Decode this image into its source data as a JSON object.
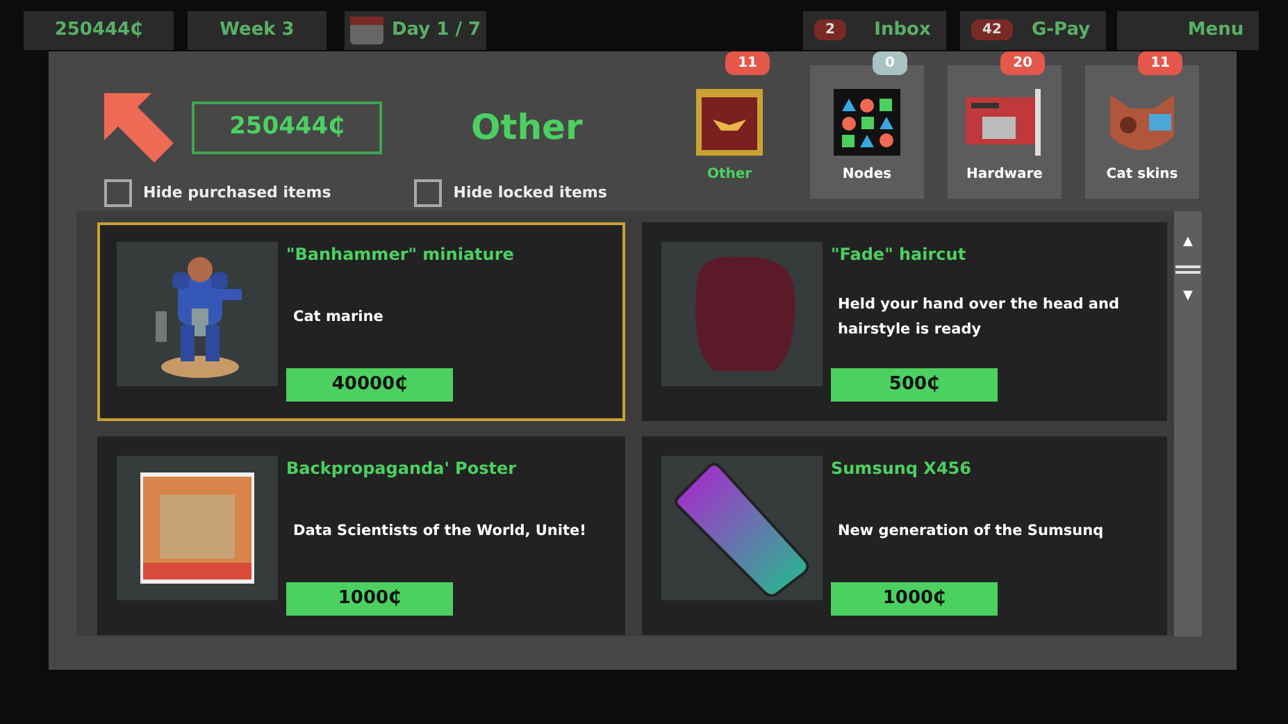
{
  "background_bar": {
    "money": "250444₵",
    "week": "Week 3",
    "day": "Day 1 / 7",
    "inbox": {
      "label": "Inbox",
      "badge": "2"
    },
    "gpay": {
      "label": "G-Pay",
      "badge": "42"
    },
    "menu": "Menu"
  },
  "shop": {
    "balance": "250444₵",
    "category_title": "Other",
    "filters": [
      {
        "label": "Hide purchased items",
        "checked": false
      },
      {
        "label": "Hide locked items",
        "checked": false
      }
    ],
    "tabs": [
      {
        "label": "Other",
        "badge": "11",
        "color": "#e4574a",
        "kind": "banner",
        "selected": true
      },
      {
        "label": "Nodes",
        "badge": "0",
        "color": "#a9c3c3",
        "kind": "shapes",
        "selected": false
      },
      {
        "label": "Hardware",
        "badge": "20",
        "color": "#e4574a",
        "kind": "card",
        "selected": false
      },
      {
        "label": "Cat skins",
        "badge": "11",
        "color": "#e4574a",
        "kind": "cat",
        "selected": false
      }
    ],
    "scrollbar": {
      "up": "▲",
      "down": "▼"
    },
    "items": [
      {
        "name": "\"Banhammer\" miniature",
        "description": "Cat marine",
        "price": "40000₵",
        "kind": "miniature",
        "selected": true
      },
      {
        "name": "\"Fade\" haircut",
        "description": "Held your hand over the head and hairstyle is ready",
        "price": "500₵",
        "kind": "hair",
        "selected": false
      },
      {
        "name": "Backpropaganda' Poster",
        "description": "Data Scientists of the World, Unite!",
        "price": "1000₵",
        "kind": "poster",
        "selected": false
      },
      {
        "name": "Sumsunq X456",
        "description": "New generation of the Sumsunq",
        "price": "1000₵",
        "kind": "phone",
        "selected": false
      }
    ]
  }
}
